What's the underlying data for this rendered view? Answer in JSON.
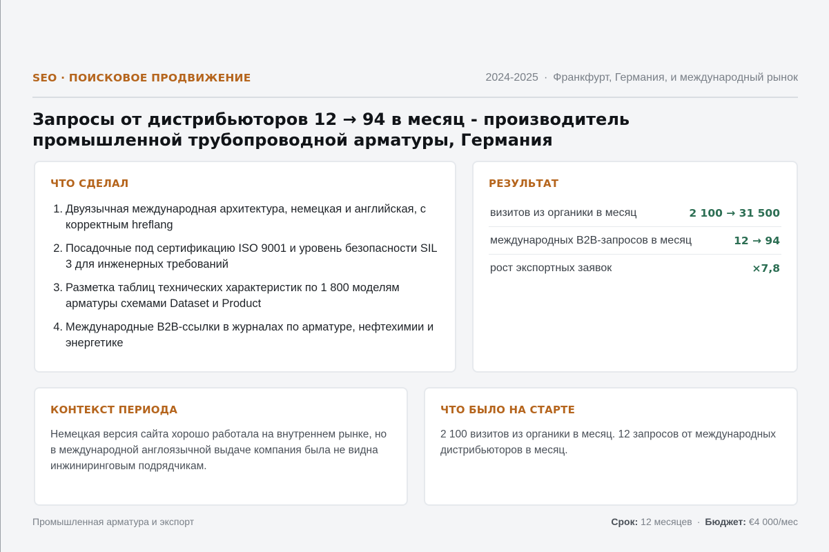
{
  "header": {
    "category": "SEO · ПОИСКОВОЕ ПРОДВИЖЕНИЕ",
    "years": "2024-2025",
    "location": "Франкфурт, Германия, и международный рынок"
  },
  "title": "Запросы от дистрибьюторов 12 → 94 в месяц - производитель промышленной трубопроводной арматуры, Германия",
  "done": {
    "label": "ЧТО СДЕЛАЛ",
    "items": [
      "Двуязычная международная архитектура, немецкая и английская, с корректным hreflang",
      "Посадочные под сертификацию ISO 9001 и уровень безопасности SIL 3 для инженерных требований",
      "Разметка таблиц технических характеристик по 1 800 моделям арматуры схемами Dataset и Product",
      "Международные B2B-ссылки в журналах по арматуре, нефтехимии и энергетике"
    ]
  },
  "result": {
    "label": "РЕЗУЛЬТАТ",
    "metrics": [
      {
        "label": "визитов из органики в месяц",
        "value": "2 100 → 31 500"
      },
      {
        "label": "международных B2B-запросов в месяц",
        "value": "12 → 94"
      },
      {
        "label": "рост экспортных заявок",
        "value": "×7,8"
      }
    ]
  },
  "context": {
    "label": "КОНТЕКСТ ПЕРИОДА",
    "text": "Немецкая версия сайта хорошо работала на внутреннем рынке, но в международной англоязычной выдаче компания была не видна инжиниринговым подрядчикам."
  },
  "start": {
    "label": "ЧТО БЫЛО НА СТАРТЕ",
    "text": "2 100 визитов из органики в месяц. 12 запросов от международных дистрибьюторов в месяц."
  },
  "footer": {
    "industry": "Промышленная арматура и экспорт",
    "term_label": "Срок:",
    "term_value": "12 месяцев",
    "budget_label": "Бюджет:",
    "budget_value": "€4 000/мес"
  },
  "colors": {
    "accent": "#b5651d",
    "metric_value": "#2c6e53",
    "background": "#f4f5f7"
  }
}
